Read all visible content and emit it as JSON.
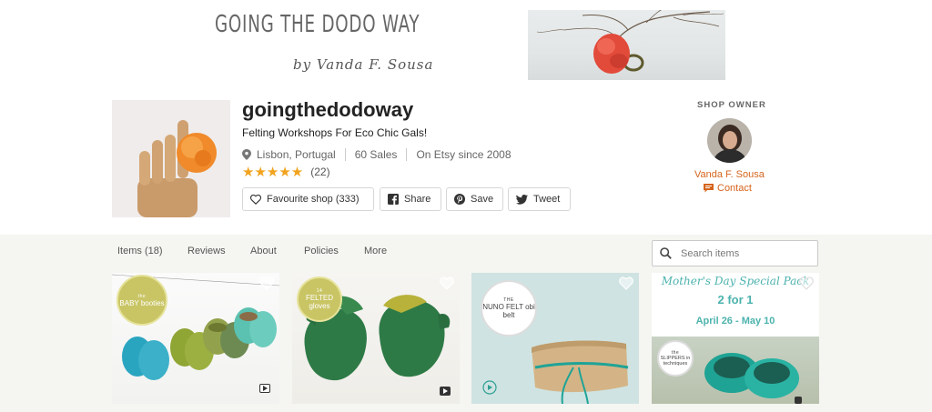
{
  "banner": {
    "title": "GOING THE DODO WAY",
    "subtitle": "by Vanda F. Sousa"
  },
  "shop": {
    "name": "goingthedodoway",
    "tagline": "Felting Workshops For Eco Chic Gals!",
    "location": "Lisbon, Portugal",
    "sales": "60 Sales",
    "since": "On Etsy since 2008",
    "stars": "★★★★★",
    "rating_value": 5,
    "review_count": "(22)",
    "buttons": {
      "favourite": "Favourite shop (333)",
      "share": "Share",
      "save": "Save",
      "tweet": "Tweet"
    }
  },
  "owner": {
    "heading": "SHOP OWNER",
    "name": "Vanda F. Sousa",
    "contact": "Contact"
  },
  "tabs": [
    {
      "label": "Items (18)"
    },
    {
      "label": "Reviews"
    },
    {
      "label": "About"
    },
    {
      "label": "Policies"
    },
    {
      "label": "More"
    }
  ],
  "search": {
    "placeholder": "Search items"
  },
  "listings": [
    {
      "badge_small": "the",
      "badge_main": "BABY booties"
    },
    {
      "badge_small": "14",
      "badge_main": "FELTED gloves"
    },
    {
      "badge_small": "THE",
      "badge_main": "NUNO FELT obi belt"
    },
    {
      "title": "Mother's Day Special Pack",
      "promo": "2 for 1",
      "dates": "April 26 - May 10",
      "badge_small": "the",
      "badge_main": "SLIPPERS in techniques"
    }
  ],
  "colors": {
    "accent_orange": "#d5641c",
    "star": "#f1a31d",
    "teal_promo": "#4cb3ad",
    "lower_bg": "#f5f5f1"
  }
}
